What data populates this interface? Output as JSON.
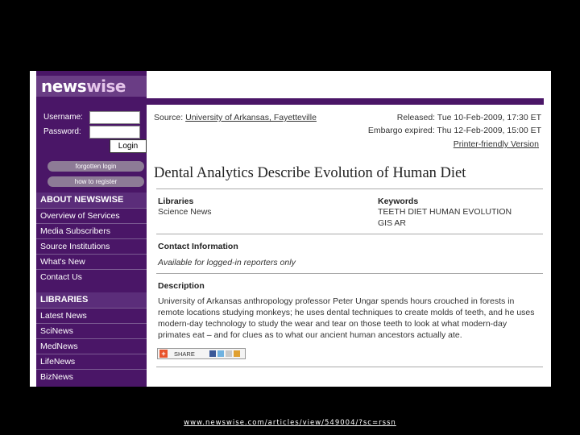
{
  "logo": {
    "part1": "news",
    "part2": "wise"
  },
  "login": {
    "username_label": "Username:",
    "password_label": "Password:",
    "username_value": "",
    "password_value": "",
    "login_button": "Login",
    "forgotten_login": "forgotten login",
    "how_to_register": "how to register"
  },
  "sidebar": {
    "about_heading": "ABOUT NEWSWISE",
    "about_items": [
      "Overview of Services",
      "Media Subscribers",
      "Source Institutions",
      "What's New",
      "Contact Us"
    ],
    "libraries_heading": "LIBRARIES",
    "library_items": [
      "Latest News",
      "SciNews",
      "MedNews",
      "LifeNews",
      "BizNews"
    ]
  },
  "article": {
    "source_label": "Source:",
    "source_name": "University of Arkansas, Fayetteville",
    "released": "Released: Tue 10-Feb-2009, 17:30 ET",
    "embargo": "Embargo expired: Thu 12-Feb-2009, 15:00 ET",
    "printer_friendly": "Printer-friendly Version",
    "title": "Dental Analytics Describe Evolution of Human Diet",
    "libraries_label": "Libraries",
    "libraries_value": "Science News",
    "keywords_label": "Keywords",
    "keywords_line1": "TEETH DIET HUMAN EVOLUTION",
    "keywords_line2": "GIS AR",
    "contact_label": "Contact Information",
    "contact_value": "Available for logged-in reporters only",
    "description_label": "Description",
    "description": "University of Arkansas anthropology professor Peter Ungar spends hours crouched in forests in remote locations studying monkeys; he uses dental techniques to create molds of teeth, and he uses modern-day technology to study the wear and tear on those teeth to look at what modern-day primates eat – and for clues as to what our ancient human ancestors actually ate.",
    "share_label": "SHARE"
  },
  "footer_url": "www.newswise.com/articles/view/549004/?sc=rssn",
  "colors": {
    "sidebar": "#4a1667",
    "logo_bar": "#6a3d85",
    "share_plus": "#e8532b"
  }
}
